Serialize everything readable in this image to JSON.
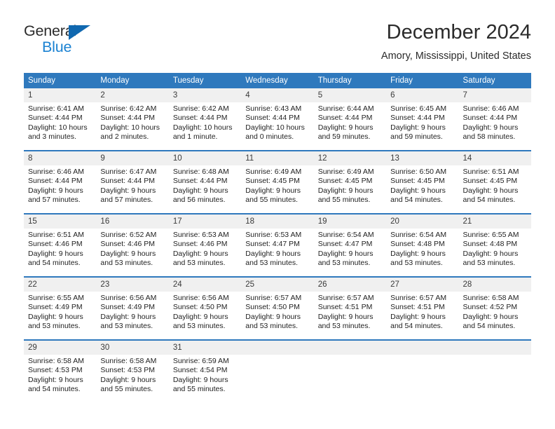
{
  "brand": {
    "name_top": "General",
    "name_bottom": "Blue",
    "triangle_icon": "triangle-icon",
    "accent_color": "#1b82d2",
    "triangle_color": "#1068b0"
  },
  "header": {
    "title": "December 2024",
    "location": "Amory, Mississippi, United States",
    "header_bg_color": "#2f79bd",
    "daynum_bg_color": "#f0f0f0"
  },
  "weekdays": [
    "Sunday",
    "Monday",
    "Tuesday",
    "Wednesday",
    "Thursday",
    "Friday",
    "Saturday"
  ],
  "labels": {
    "sunrise": "Sunrise:",
    "sunset": "Sunset:",
    "daylight": "Daylight:"
  },
  "weeks": [
    [
      {
        "day": "1",
        "sunrise": "Sunrise: 6:41 AM",
        "sunset": "Sunset: 4:44 PM",
        "daylight_1": "Daylight: 10 hours",
        "daylight_2": "and 3 minutes."
      },
      {
        "day": "2",
        "sunrise": "Sunrise: 6:42 AM",
        "sunset": "Sunset: 4:44 PM",
        "daylight_1": "Daylight: 10 hours",
        "daylight_2": "and 2 minutes."
      },
      {
        "day": "3",
        "sunrise": "Sunrise: 6:42 AM",
        "sunset": "Sunset: 4:44 PM",
        "daylight_1": "Daylight: 10 hours",
        "daylight_2": "and 1 minute."
      },
      {
        "day": "4",
        "sunrise": "Sunrise: 6:43 AM",
        "sunset": "Sunset: 4:44 PM",
        "daylight_1": "Daylight: 10 hours",
        "daylight_2": "and 0 minutes."
      },
      {
        "day": "5",
        "sunrise": "Sunrise: 6:44 AM",
        "sunset": "Sunset: 4:44 PM",
        "daylight_1": "Daylight: 9 hours",
        "daylight_2": "and 59 minutes."
      },
      {
        "day": "6",
        "sunrise": "Sunrise: 6:45 AM",
        "sunset": "Sunset: 4:44 PM",
        "daylight_1": "Daylight: 9 hours",
        "daylight_2": "and 59 minutes."
      },
      {
        "day": "7",
        "sunrise": "Sunrise: 6:46 AM",
        "sunset": "Sunset: 4:44 PM",
        "daylight_1": "Daylight: 9 hours",
        "daylight_2": "and 58 minutes."
      }
    ],
    [
      {
        "day": "8",
        "sunrise": "Sunrise: 6:46 AM",
        "sunset": "Sunset: 4:44 PM",
        "daylight_1": "Daylight: 9 hours",
        "daylight_2": "and 57 minutes."
      },
      {
        "day": "9",
        "sunrise": "Sunrise: 6:47 AM",
        "sunset": "Sunset: 4:44 PM",
        "daylight_1": "Daylight: 9 hours",
        "daylight_2": "and 57 minutes."
      },
      {
        "day": "10",
        "sunrise": "Sunrise: 6:48 AM",
        "sunset": "Sunset: 4:44 PM",
        "daylight_1": "Daylight: 9 hours",
        "daylight_2": "and 56 minutes."
      },
      {
        "day": "11",
        "sunrise": "Sunrise: 6:49 AM",
        "sunset": "Sunset: 4:45 PM",
        "daylight_1": "Daylight: 9 hours",
        "daylight_2": "and 55 minutes."
      },
      {
        "day": "12",
        "sunrise": "Sunrise: 6:49 AM",
        "sunset": "Sunset: 4:45 PM",
        "daylight_1": "Daylight: 9 hours",
        "daylight_2": "and 55 minutes."
      },
      {
        "day": "13",
        "sunrise": "Sunrise: 6:50 AM",
        "sunset": "Sunset: 4:45 PM",
        "daylight_1": "Daylight: 9 hours",
        "daylight_2": "and 54 minutes."
      },
      {
        "day": "14",
        "sunrise": "Sunrise: 6:51 AM",
        "sunset": "Sunset: 4:45 PM",
        "daylight_1": "Daylight: 9 hours",
        "daylight_2": "and 54 minutes."
      }
    ],
    [
      {
        "day": "15",
        "sunrise": "Sunrise: 6:51 AM",
        "sunset": "Sunset: 4:46 PM",
        "daylight_1": "Daylight: 9 hours",
        "daylight_2": "and 54 minutes."
      },
      {
        "day": "16",
        "sunrise": "Sunrise: 6:52 AM",
        "sunset": "Sunset: 4:46 PM",
        "daylight_1": "Daylight: 9 hours",
        "daylight_2": "and 53 minutes."
      },
      {
        "day": "17",
        "sunrise": "Sunrise: 6:53 AM",
        "sunset": "Sunset: 4:46 PM",
        "daylight_1": "Daylight: 9 hours",
        "daylight_2": "and 53 minutes."
      },
      {
        "day": "18",
        "sunrise": "Sunrise: 6:53 AM",
        "sunset": "Sunset: 4:47 PM",
        "daylight_1": "Daylight: 9 hours",
        "daylight_2": "and 53 minutes."
      },
      {
        "day": "19",
        "sunrise": "Sunrise: 6:54 AM",
        "sunset": "Sunset: 4:47 PM",
        "daylight_1": "Daylight: 9 hours",
        "daylight_2": "and 53 minutes."
      },
      {
        "day": "20",
        "sunrise": "Sunrise: 6:54 AM",
        "sunset": "Sunset: 4:48 PM",
        "daylight_1": "Daylight: 9 hours",
        "daylight_2": "and 53 minutes."
      },
      {
        "day": "21",
        "sunrise": "Sunrise: 6:55 AM",
        "sunset": "Sunset: 4:48 PM",
        "daylight_1": "Daylight: 9 hours",
        "daylight_2": "and 53 minutes."
      }
    ],
    [
      {
        "day": "22",
        "sunrise": "Sunrise: 6:55 AM",
        "sunset": "Sunset: 4:49 PM",
        "daylight_1": "Daylight: 9 hours",
        "daylight_2": "and 53 minutes."
      },
      {
        "day": "23",
        "sunrise": "Sunrise: 6:56 AM",
        "sunset": "Sunset: 4:49 PM",
        "daylight_1": "Daylight: 9 hours",
        "daylight_2": "and 53 minutes."
      },
      {
        "day": "24",
        "sunrise": "Sunrise: 6:56 AM",
        "sunset": "Sunset: 4:50 PM",
        "daylight_1": "Daylight: 9 hours",
        "daylight_2": "and 53 minutes."
      },
      {
        "day": "25",
        "sunrise": "Sunrise: 6:57 AM",
        "sunset": "Sunset: 4:50 PM",
        "daylight_1": "Daylight: 9 hours",
        "daylight_2": "and 53 minutes."
      },
      {
        "day": "26",
        "sunrise": "Sunrise: 6:57 AM",
        "sunset": "Sunset: 4:51 PM",
        "daylight_1": "Daylight: 9 hours",
        "daylight_2": "and 53 minutes."
      },
      {
        "day": "27",
        "sunrise": "Sunrise: 6:57 AM",
        "sunset": "Sunset: 4:51 PM",
        "daylight_1": "Daylight: 9 hours",
        "daylight_2": "and 54 minutes."
      },
      {
        "day": "28",
        "sunrise": "Sunrise: 6:58 AM",
        "sunset": "Sunset: 4:52 PM",
        "daylight_1": "Daylight: 9 hours",
        "daylight_2": "and 54 minutes."
      }
    ],
    [
      {
        "day": "29",
        "sunrise": "Sunrise: 6:58 AM",
        "sunset": "Sunset: 4:53 PM",
        "daylight_1": "Daylight: 9 hours",
        "daylight_2": "and 54 minutes."
      },
      {
        "day": "30",
        "sunrise": "Sunrise: 6:58 AM",
        "sunset": "Sunset: 4:53 PM",
        "daylight_1": "Daylight: 9 hours",
        "daylight_2": "and 55 minutes."
      },
      {
        "day": "31",
        "sunrise": "Sunrise: 6:59 AM",
        "sunset": "Sunset: 4:54 PM",
        "daylight_1": "Daylight: 9 hours",
        "daylight_2": "and 55 minutes."
      },
      {
        "day": "",
        "sunrise": "",
        "sunset": "",
        "daylight_1": "",
        "daylight_2": ""
      },
      {
        "day": "",
        "sunrise": "",
        "sunset": "",
        "daylight_1": "",
        "daylight_2": ""
      },
      {
        "day": "",
        "sunrise": "",
        "sunset": "",
        "daylight_1": "",
        "daylight_2": ""
      },
      {
        "day": "",
        "sunrise": "",
        "sunset": "",
        "daylight_1": "",
        "daylight_2": ""
      }
    ]
  ]
}
